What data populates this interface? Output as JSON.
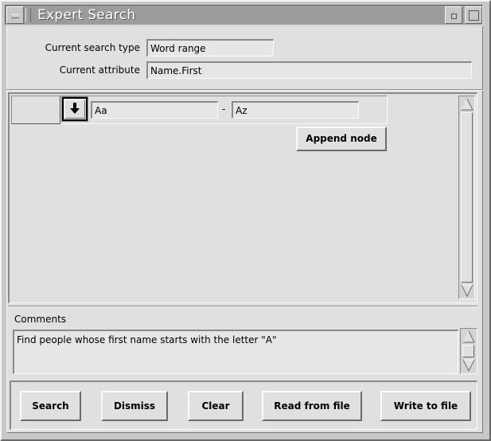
{
  "window": {
    "title": "Expert Search"
  },
  "header": {
    "search_type_label": "Current search type",
    "search_type_value": "Word range",
    "attribute_label": "Current attribute",
    "attribute_value": "Name.First"
  },
  "node": {
    "from_value": "Aa",
    "separator": "-",
    "to_value": "Az",
    "append_label": "Append node"
  },
  "comments": {
    "label": "Comments",
    "text": "Find people whose first name starts with the letter \"A\""
  },
  "buttons": {
    "search": "Search",
    "dismiss": "Dismiss",
    "clear": "Clear",
    "read": "Read from file",
    "write": "Write to file"
  }
}
